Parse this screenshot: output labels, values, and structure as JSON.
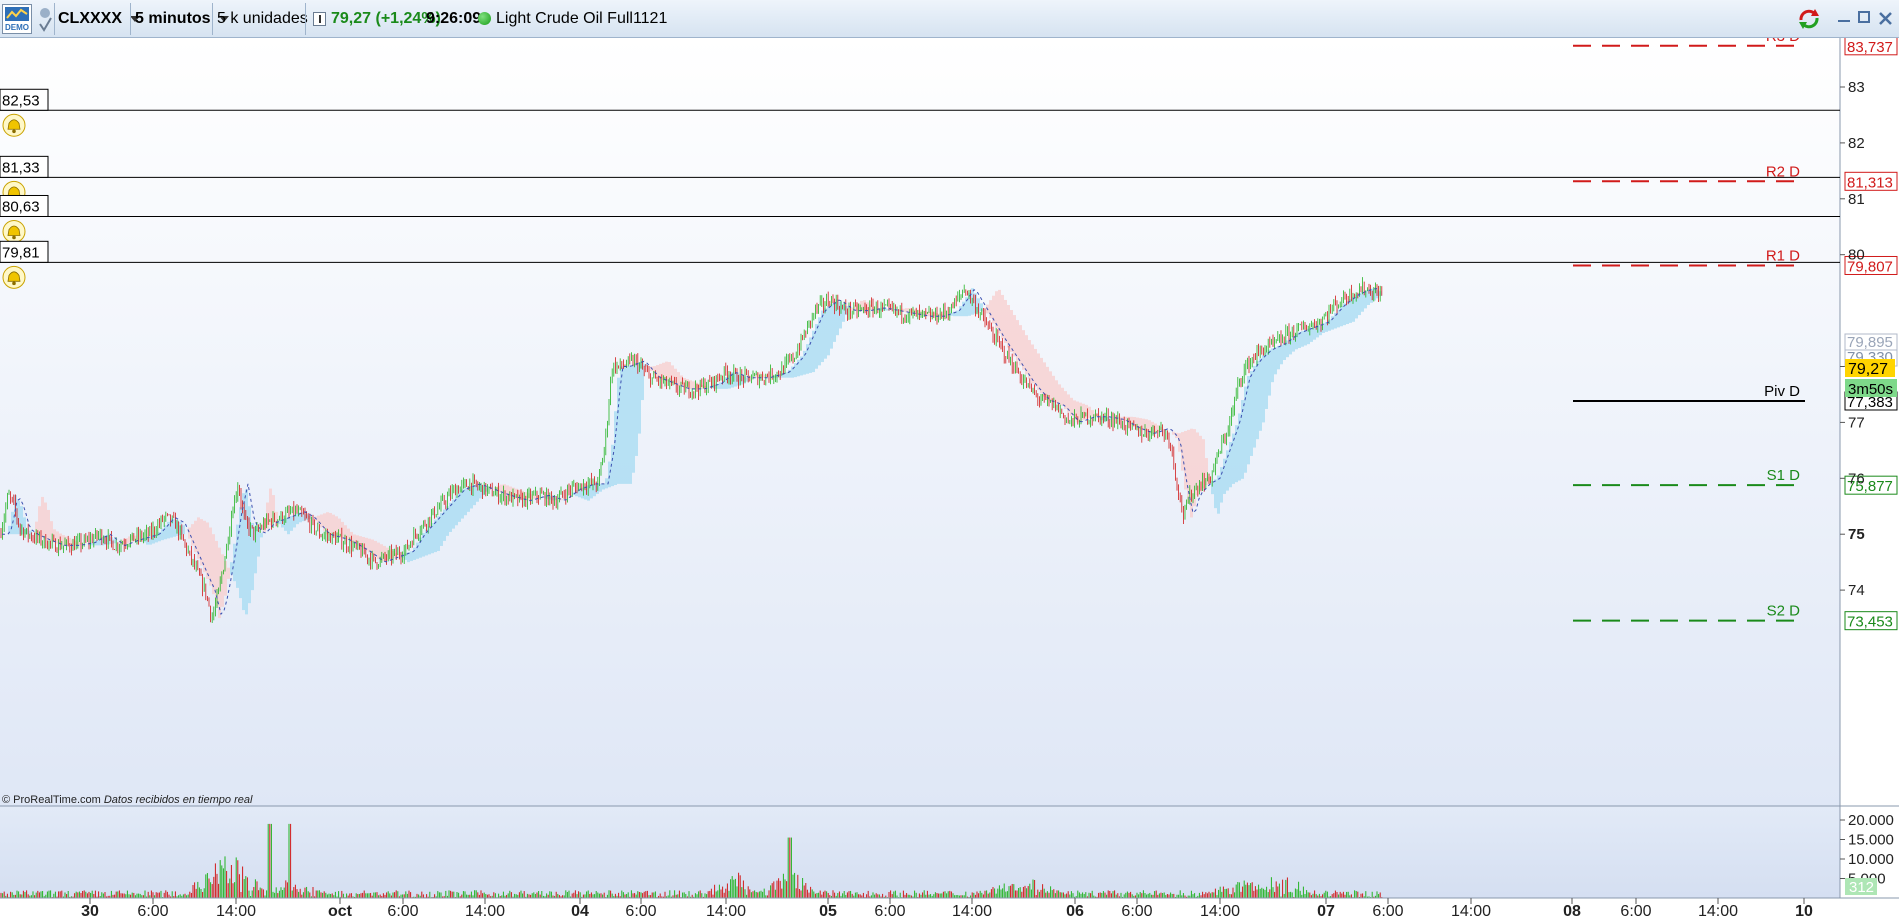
{
  "toolbar": {
    "demo_label": "DEMO",
    "instrument": "CLXXXX",
    "timeframe": "5 minutos",
    "units": "5 k unidades",
    "last_price": "79,27",
    "change": "(+1,24%)",
    "time": "9:26:09",
    "instrument_name": "Light Crude Oil Full1121"
  },
  "price_axis": {
    "ticks": [
      "83",
      "82",
      "81",
      "80",
      "78",
      "77",
      "76",
      "75",
      "74"
    ]
  },
  "levels": {
    "r3": {
      "label": "R3 D",
      "value": "83,737",
      "color": "#d11a1a"
    },
    "r2": {
      "label": "R2 D",
      "value": "81,313",
      "color": "#d11a1a"
    },
    "r1": {
      "label": "R1 D",
      "value": "79,807",
      "color": "#d11a1a"
    },
    "piv": {
      "label": "Piv D",
      "value": "77,383",
      "color": "#000000"
    },
    "s1": {
      "label": "S1 D",
      "value": "75,877",
      "color": "#1a8a1a"
    },
    "s2": {
      "label": "S2 D",
      "value": "73,453",
      "color": "#1a8a1a"
    }
  },
  "alerts": [
    "82,53",
    "81,33",
    "80,63",
    "79,81"
  ],
  "current": {
    "price": "79,27",
    "countdown": "3m50s",
    "hidden_a": "79,895",
    "hidden_b": "79,330"
  },
  "watermark": {
    "brand": "© ProRealTime.com",
    "note": "Datos recibidos en tiempo real"
  },
  "volume_axis": {
    "ticks": [
      "20.000",
      "15.000",
      "10.000",
      "5.000"
    ],
    "current": "312"
  },
  "time_axis": [
    "30",
    "6:00",
    "14:00",
    "oct",
    "6:00",
    "14:00",
    "04",
    "6:00",
    "14:00",
    "05",
    "6:00",
    "14:00",
    "06",
    "6:00",
    "14:00",
    "07",
    "6:00",
    "14:00",
    "08",
    "6:00",
    "14:00",
    "10"
  ],
  "colors": {
    "up": "#22b322",
    "down": "#d11a1a",
    "cloud_up": "#a9dcf3",
    "cloud_down": "#f7cfcf"
  },
  "chart_data": {
    "type": "candlestick",
    "instrument": "CLXXXX",
    "timeframe": "5 minutos",
    "ylim": [
      73.2,
      83.9
    ],
    "x_labels": [
      "30",
      "6:00",
      "14:00",
      "oct",
      "6:00",
      "14:00",
      "04",
      "6:00",
      "14:00",
      "05",
      "6:00",
      "14:00",
      "06",
      "6:00",
      "14:00",
      "07",
      "6:00",
      "14:00",
      "08",
      "6:00",
      "14:00",
      "10"
    ],
    "price_path": [
      [
        0,
        75.0
      ],
      [
        4,
        75.3
      ],
      [
        8,
        75.7
      ],
      [
        14,
        75.5
      ],
      [
        20,
        75.1
      ],
      [
        28,
        75.0
      ],
      [
        40,
        74.9
      ],
      [
        55,
        74.8
      ],
      [
        70,
        74.8
      ],
      [
        85,
        74.85
      ],
      [
        100,
        75.0
      ],
      [
        115,
        74.8
      ],
      [
        130,
        74.9
      ],
      [
        150,
        75.0
      ],
      [
        165,
        75.3
      ],
      [
        175,
        75.2
      ],
      [
        185,
        74.8
      ],
      [
        195,
        74.4
      ],
      [
        205,
        74.0
      ],
      [
        212,
        73.5
      ],
      [
        218,
        73.9
      ],
      [
        225,
        74.6
      ],
      [
        232,
        75.4
      ],
      [
        238,
        75.9
      ],
      [
        245,
        75.2
      ],
      [
        255,
        75.0
      ],
      [
        265,
        75.2
      ],
      [
        280,
        75.3
      ],
      [
        295,
        75.4
      ],
      [
        305,
        75.3
      ],
      [
        320,
        75.0
      ],
      [
        340,
        74.9
      ],
      [
        360,
        74.7
      ],
      [
        375,
        74.5
      ],
      [
        390,
        74.6
      ],
      [
        405,
        74.7
      ],
      [
        415,
        75.0
      ],
      [
        425,
        75.2
      ],
      [
        440,
        75.5
      ],
      [
        455,
        75.8
      ],
      [
        470,
        75.9
      ],
      [
        485,
        75.8
      ],
      [
        500,
        75.7
      ],
      [
        520,
        75.6
      ],
      [
        540,
        75.7
      ],
      [
        555,
        75.6
      ],
      [
        570,
        75.8
      ],
      [
        585,
        75.9
      ],
      [
        598,
        75.9
      ],
      [
        605,
        76.6
      ],
      [
        612,
        78.0
      ],
      [
        620,
        78.0
      ],
      [
        635,
        78.1
      ],
      [
        650,
        77.8
      ],
      [
        665,
        77.7
      ],
      [
        680,
        77.6
      ],
      [
        695,
        77.6
      ],
      [
        712,
        77.7
      ],
      [
        725,
        77.9
      ],
      [
        740,
        77.8
      ],
      [
        760,
        77.8
      ],
      [
        780,
        77.9
      ],
      [
        795,
        78.2
      ],
      [
        805,
        78.6
      ],
      [
        815,
        79.0
      ],
      [
        830,
        79.2
      ],
      [
        845,
        79.0
      ],
      [
        860,
        79.0
      ],
      [
        875,
        79.05
      ],
      [
        890,
        79.0
      ],
      [
        905,
        78.95
      ],
      [
        920,
        78.9
      ],
      [
        935,
        78.9
      ],
      [
        950,
        79.0
      ],
      [
        965,
        79.4
      ],
      [
        975,
        79.1
      ],
      [
        985,
        78.8
      ],
      [
        995,
        78.5
      ],
      [
        1010,
        78.1
      ],
      [
        1025,
        77.7
      ],
      [
        1040,
        77.4
      ],
      [
        1055,
        77.3
      ],
      [
        1070,
        77.0
      ],
      [
        1085,
        77.1
      ],
      [
        1100,
        77.1
      ],
      [
        1115,
        77.05
      ],
      [
        1130,
        76.9
      ],
      [
        1145,
        76.8
      ],
      [
        1160,
        76.9
      ],
      [
        1170,
        76.7
      ],
      [
        1178,
        75.8
      ],
      [
        1184,
        75.3
      ],
      [
        1190,
        75.7
      ],
      [
        1200,
        75.9
      ],
      [
        1210,
        76.0
      ],
      [
        1220,
        76.5
      ],
      [
        1230,
        77.0
      ],
      [
        1240,
        77.8
      ],
      [
        1250,
        78.1
      ],
      [
        1262,
        78.3
      ],
      [
        1275,
        78.4
      ],
      [
        1290,
        78.6
      ],
      [
        1305,
        78.7
      ],
      [
        1320,
        78.8
      ],
      [
        1335,
        79.1
      ],
      [
        1350,
        79.3
      ],
      [
        1365,
        79.4
      ],
      [
        1380,
        79.3
      ]
    ],
    "pivot_levels": {
      "R3 D": 83.737,
      "R2 D": 81.313,
      "R1 D": 79.807,
      "Piv D": 77.383,
      "S1 D": 75.877,
      "S2 D": 73.453
    },
    "alert_levels": [
      82.53,
      81.33,
      80.63,
      79.81
    ],
    "last": 79.27,
    "change_pct": 1.24,
    "volume_ylim": [
      0,
      20000
    ]
  }
}
